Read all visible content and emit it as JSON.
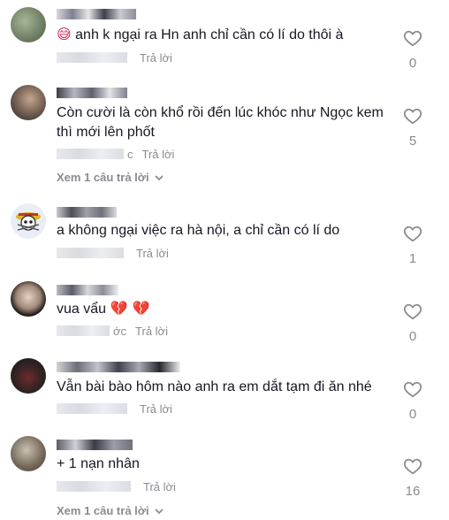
{
  "comments": [
    {
      "text": "anh k ngại ra Hn anh chỉ cần có lí do thôi à",
      "prefix_emoji": "😅",
      "reply": "Trả lời",
      "likes": "0",
      "meta_suffix": ""
    },
    {
      "text": "Còn cười là còn khổ rồi đến lúc khóc như Ngọc kem thì mới lên phốt",
      "prefix_emoji": "",
      "reply": "Trả lời",
      "likes": "5",
      "meta_suffix": "c",
      "more": "Xem 1 câu trả lời"
    },
    {
      "text": "a không ngại việc ra hà nội, a chỉ cần có lí do",
      "prefix_emoji": "",
      "reply": "Trả lời",
      "likes": "1",
      "meta_suffix": ""
    },
    {
      "text": "vua vẩu",
      "suffix_emoji": "💔 💔",
      "reply": "Trả lời",
      "likes": "0",
      "meta_suffix": "ớc"
    },
    {
      "text": "Vẫn bài bào hôm nào anh ra em dắt tạm đi ăn nhé",
      "prefix_emoji": "",
      "reply": "Trả lời",
      "likes": "0",
      "meta_suffix": ""
    },
    {
      "text": "+ 1 nạn nhân",
      "prefix_emoji": "",
      "reply": "Trả lời",
      "likes": "16",
      "meta_suffix": "",
      "more": "Xem 1 câu trả lời"
    }
  ],
  "icons": {
    "like": "heart-outline-icon",
    "more": "chevron-down-icon"
  }
}
